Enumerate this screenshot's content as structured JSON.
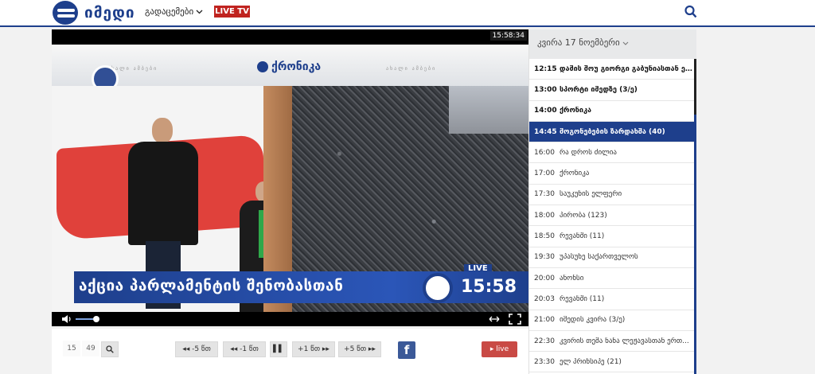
{
  "header": {
    "logo_text": "იმედი",
    "nav_label": "გადაცემები",
    "live_tv_label": "LIVE TV"
  },
  "player": {
    "timestamp": "15:58:34",
    "channel_name": "ქრონიკა",
    "banner_deco_left": "ახალი ამბები",
    "banner_deco_right": "ახალი ამბები",
    "lower_third_text": "აქცია პარლამენტის შენობასთან",
    "lower_third_time": "15:58",
    "live_flag": "LIVE",
    "volume_level": 0.6
  },
  "toolbar": {
    "page_current": "15",
    "page_total": "49",
    "back5_label": "◂◂ -5 წთ",
    "back1_label": "◂◂ -1 წთ",
    "pause_label": "▌▌",
    "fwd1_label": "+1 წთ ▸▸",
    "fwd5_label": "+5 წთ ▸▸",
    "fb_label": "f",
    "live_label": "▸ live"
  },
  "schedule": {
    "date_label": "კვირა 17 ნოემბერი",
    "items": [
      {
        "time": "12:15",
        "title": "დამის შოუ გიორგი გაბუნიასთან ერ...",
        "state": "past"
      },
      {
        "time": "13:00",
        "title": "სპორტი იმედზე (3/ე)",
        "state": "past"
      },
      {
        "time": "14:00",
        "title": "ქრონიკა",
        "state": "past"
      },
      {
        "time": "14:45",
        "title": "მოგონებების ზარდახშა (40)",
        "state": "active"
      },
      {
        "time": "16:00",
        "title": "რა დროს ძილია",
        "state": "upcoming"
      },
      {
        "time": "17:00",
        "title": "ქრონიკა",
        "state": "upcoming"
      },
      {
        "time": "17:30",
        "title": "საუკუნის ელფერი",
        "state": "upcoming"
      },
      {
        "time": "18:00",
        "title": "პირობა (123)",
        "state": "upcoming"
      },
      {
        "time": "18:50",
        "title": "რევანში (11)",
        "state": "upcoming"
      },
      {
        "time": "19:30",
        "title": "უპასუხე საქართველოს",
        "state": "upcoming"
      },
      {
        "time": "20:00",
        "title": "ანონსი",
        "state": "upcoming"
      },
      {
        "time": "20:03",
        "title": "რევანში (11)",
        "state": "upcoming"
      },
      {
        "time": "21:00",
        "title": "იმედის კვირა (3/ე)",
        "state": "upcoming"
      },
      {
        "time": "22:30",
        "title": "კვირის თემა ნანა ლეჟავასთან ერთ...",
        "state": "upcoming"
      },
      {
        "time": "23:30",
        "title": "ელ პრინსიპე (21)",
        "state": "upcoming"
      }
    ]
  },
  "colors": {
    "brand_blue": "#1e3f8c",
    "live_red": "#c0231f",
    "facebook": "#3b5998"
  }
}
